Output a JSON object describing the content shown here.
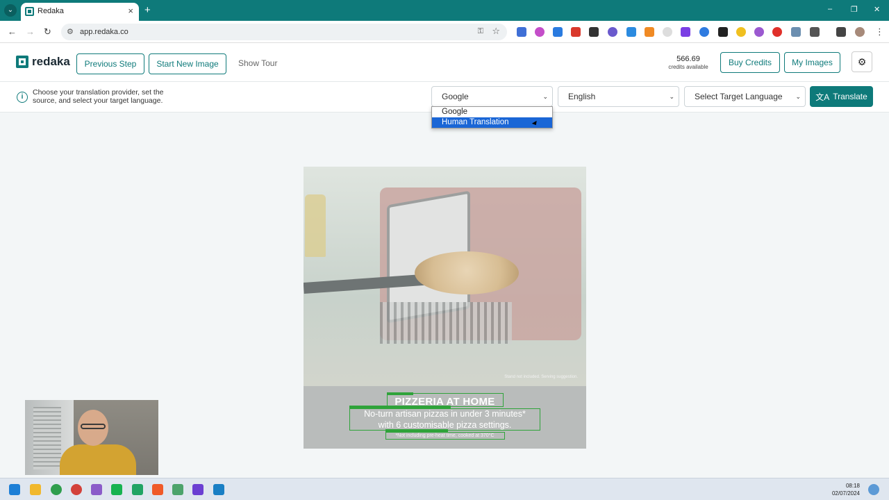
{
  "browser": {
    "tab_title": "Redaka",
    "url": "app.redaka.co",
    "window_controls": [
      "–",
      "❐",
      "✕"
    ]
  },
  "header": {
    "logo_text": "redaka",
    "previous_step": "Previous Step",
    "start_new_image": "Start New Image",
    "show_tour": "Show Tour",
    "credits_value": "566.69",
    "credits_label": "credits available",
    "buy_credits": "Buy Credits",
    "my_images": "My Images"
  },
  "settings": {
    "help_text": "Choose your translation provider, set the source, and select your target language.",
    "provider_value": "Google",
    "source_language": "English",
    "target_language": "Select Target Language",
    "translate_label": "Translate"
  },
  "provider_dropdown": {
    "options": [
      "Google",
      "Human Translation"
    ],
    "highlighted": "Human Translation"
  },
  "preview": {
    "headline": "PIZZERIA AT HOME",
    "subline_1": "No-turn artisan pizzas in under 3 minutes*",
    "subline_2": "with 6 customisable pizza settings.",
    "footnote": "*Not including pre-heat time, cooked at 370°C",
    "serving_note": "Stand not included. Serving suggestion."
  },
  "taskbar": {
    "time": "08:18",
    "date": "02/07/2024"
  },
  "colors": {
    "brand": "#0e7a7a",
    "dropdown_highlight": "#1a66d6",
    "text_box_outline": "#2fa33a"
  }
}
